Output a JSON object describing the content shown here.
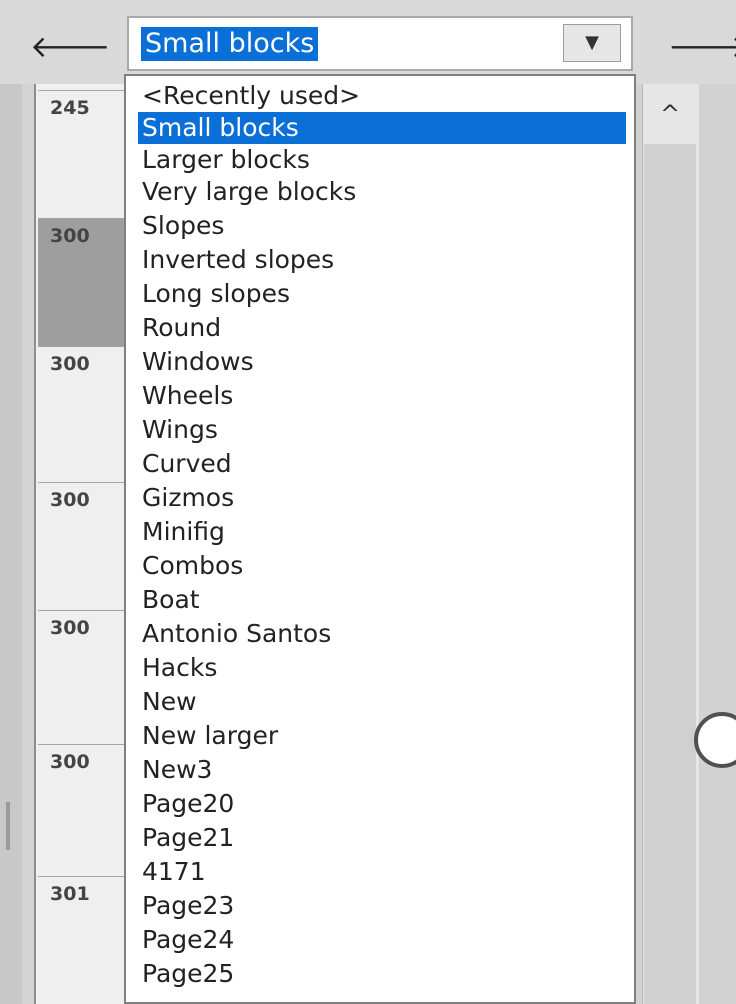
{
  "toolbar": {
    "prev_icon": "arrow-left-icon",
    "next_icon": "arrow-right-icon",
    "prev_glyph": "🡐",
    "next_glyph": "🡒",
    "combo_value": "Small blocks",
    "dropdown_glyph": "▼"
  },
  "parts": [
    {
      "id": "245",
      "selected": false
    },
    {
      "id": "300",
      "selected": true
    },
    {
      "id": "300",
      "selected": false
    },
    {
      "id": "300",
      "selected": false
    },
    {
      "id": "300",
      "selected": false
    },
    {
      "id": "300",
      "selected": false
    },
    {
      "id": "301",
      "selected": false
    }
  ],
  "scrollbar": {
    "up_glyph": "^"
  },
  "dropdown": {
    "selected_index": 1,
    "items": [
      "<Recently used>",
      "Small blocks",
      "Larger blocks",
      "Very large blocks",
      "Slopes",
      "Inverted slopes",
      "Long slopes",
      "Round",
      "Windows",
      "Wheels",
      "Wings",
      "Curved",
      "Gizmos",
      "Minifig",
      "Combos",
      "Boat",
      "Antonio Santos",
      "Hacks",
      "New",
      "New larger",
      "New3",
      "Page20",
      "Page21",
      "4171",
      "Page23",
      "Page24",
      "Page25"
    ]
  },
  "colors": {
    "selection": "#0a6fd6",
    "panel": "#f0f0f0",
    "selected_part": "#9e9e9e"
  }
}
